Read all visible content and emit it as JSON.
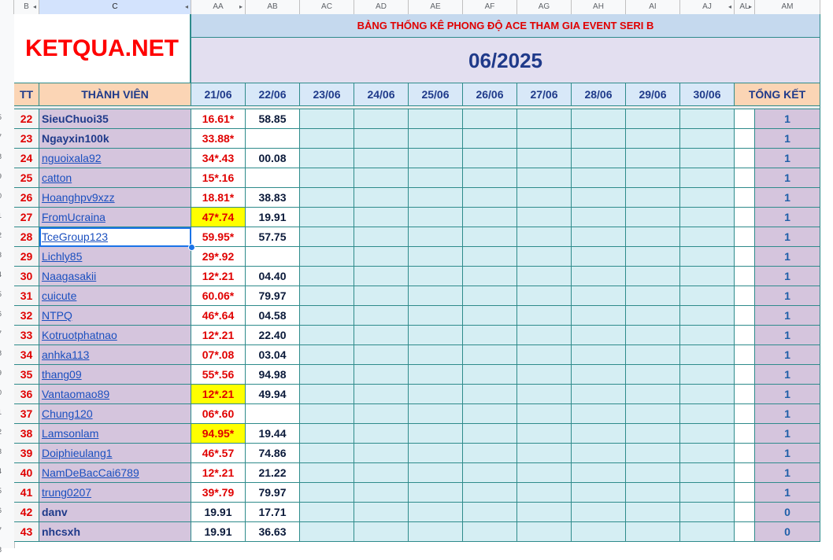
{
  "col_headers": [
    {
      "label": "B",
      "w": 32,
      "arrow": "◂"
    },
    {
      "label": "C",
      "w": 193,
      "arrow": "◂"
    },
    {
      "label": "AA",
      "w": 69,
      "arrow": "▸"
    },
    {
      "label": "AB",
      "w": 69
    },
    {
      "label": "AC",
      "w": 69
    },
    {
      "label": "AD",
      "w": 69
    },
    {
      "label": "AE",
      "w": 69
    },
    {
      "label": "AF",
      "w": 69
    },
    {
      "label": "AG",
      "w": 69
    },
    {
      "label": "AH",
      "w": 69
    },
    {
      "label": "AI",
      "w": 69
    },
    {
      "label": "AJ",
      "w": 69,
      "arrow": "◂"
    },
    {
      "label": "AL",
      "w": 26,
      "arrow": "▸"
    },
    {
      "label": "AM",
      "w": 83
    }
  ],
  "logo": "KETQUA.NET",
  "banner": "BẢNG THỐNG KÊ PHONG ĐỘ ACE THAM GIA EVENT SERI B",
  "month": "06/2025",
  "head": {
    "tt": "TT",
    "member": "THÀNH VIÊN",
    "total": "TỔNG KẾT",
    "dates": [
      "21/06",
      "22/06",
      "23/06",
      "24/06",
      "25/06",
      "26/06",
      "27/06",
      "28/06",
      "29/06",
      "30/06"
    ]
  },
  "row_numbers": [
    "",
    "",
    "",
    "",
    "5",
    "7",
    "8",
    "9",
    "0",
    "1",
    "2",
    "3",
    "4",
    "5",
    "6",
    "7",
    "8",
    "9",
    "0",
    "1",
    "2",
    "3",
    "4",
    "5",
    "6",
    "7",
    "8"
  ],
  "rows": [
    {
      "tt": "22",
      "name": "SieuChuoi35",
      "bold": true,
      "d21": "16.61*",
      "d22": "58.85",
      "total": "1"
    },
    {
      "tt": "23",
      "name": "Ngayxin100k",
      "bold": true,
      "d21": "33.88*",
      "d22": "",
      "total": "1"
    },
    {
      "tt": "24",
      "name": "nguoixala92",
      "d21": "34*.43",
      "d22": "00.08",
      "total": "1"
    },
    {
      "tt": "25",
      "name": "catton",
      "d21": "15*.16",
      "d22": "",
      "total": "1"
    },
    {
      "tt": "26",
      "name": "Hoanghpv9xzz",
      "d21": "18.81*",
      "d22": "38.83",
      "total": "1"
    },
    {
      "tt": "27",
      "name": "FromUcraina",
      "d21": "47*.74",
      "yellow": true,
      "d22": "19.91",
      "total": "1"
    },
    {
      "tt": "28",
      "name": "TceGroup123",
      "d21": "59.95*",
      "d22": "57.75",
      "total": "1",
      "selected": true
    },
    {
      "tt": "29",
      "name": "Lichly85",
      "d21": "29*.92",
      "d22": "",
      "total": "1"
    },
    {
      "tt": "30",
      "name": "Naagasakii",
      "d21": "12*.21",
      "d22": "04.40",
      "total": "1"
    },
    {
      "tt": "31",
      "name": "cuicute",
      "d21": "60.06*",
      "d22": "79.97",
      "total": "1"
    },
    {
      "tt": "32",
      "name": "NTPQ",
      "d21": "46*.64",
      "d22": "04.58",
      "total": "1"
    },
    {
      "tt": "33",
      "name": "Kotruotphatnao",
      "d21": "12*.21",
      "d22": "22.40",
      "total": "1"
    },
    {
      "tt": "34",
      "name": "anhka113",
      "d21": "07*.08",
      "d22": "03.04",
      "total": "1"
    },
    {
      "tt": "35",
      "name": "thang09",
      "d21": "55*.56",
      "d22": "94.98",
      "total": "1"
    },
    {
      "tt": "36",
      "name": "Vantaomao89",
      "d21": "12*.21",
      "yellow": true,
      "d22": "49.94",
      "total": "1"
    },
    {
      "tt": "37",
      "name": "Chung120",
      "d21": "06*.60",
      "d22": "",
      "total": "1"
    },
    {
      "tt": "38",
      "name": "Lamsonlam",
      "d21": "94.95*",
      "yellow": true,
      "d22": "19.44",
      "total": "1"
    },
    {
      "tt": "39",
      "name": "Doiphieulang1",
      "d21": "46*.57",
      "d22": "74.86",
      "total": "1"
    },
    {
      "tt": "40",
      "name": "NamDeBacCai6789",
      "d21": "12*.21",
      "d22": "21.22",
      "total": "1"
    },
    {
      "tt": "41",
      "name": "trung0207",
      "d21": "39*.79",
      "d22": "79.97",
      "total": "1"
    },
    {
      "tt": "42",
      "name": "danv",
      "bold": true,
      "d21": "19.91",
      "black21": true,
      "d22": "17.71",
      "total": "0"
    },
    {
      "tt": "43",
      "name": "nhcsxh",
      "bold": true,
      "d21": "19.91",
      "black21": true,
      "d22": "36.63",
      "total": "0"
    }
  ],
  "colors": {
    "title": "#ff0000",
    "banner_bg": "#c5d9ee",
    "month_bg": "#e3dff0",
    "header_bg": "#fbd5b5",
    "date_header_bg": "#d8e8f8",
    "member_bg": "#d5c5dd",
    "empty_bg": "#d5eef3",
    "yellow": "#ffff00"
  }
}
